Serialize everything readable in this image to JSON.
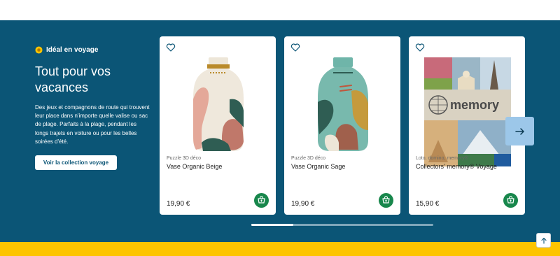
{
  "promo": {
    "tag": "Idéal en voyage",
    "headline": "Tout pour vos vacances",
    "description": "Des jeux et compagnons de route qui trouvent leur place dans n'importe quelle valise ou sac de plage. Parfaits à la plage, pendant les longs trajets en voiture ou pour les belles soirées d'été.",
    "cta": "Voir la collection voyage"
  },
  "products": [
    {
      "category": "Puzzle 3D déco",
      "title": "Vase Organic Beige",
      "price": "19,90 €"
    },
    {
      "category": "Puzzle 3D déco",
      "title": "Vase Organic Sage",
      "price": "19,90 €"
    },
    {
      "category": "Loto, domino, memory®",
      "title": "Collectors' memory® Voyage",
      "price": "15,90 €"
    }
  ],
  "box_text": "memory",
  "carousel": {
    "progress": 0.23
  },
  "colors": {
    "band": "#0b5576",
    "accent_yellow": "#fdc400",
    "cart_green": "#18874c",
    "next_button": "#9cc7e9"
  },
  "icons": [
    "sun-icon",
    "heart-icon",
    "cart-icon",
    "arrow-right-icon",
    "arrow-up-icon"
  ]
}
